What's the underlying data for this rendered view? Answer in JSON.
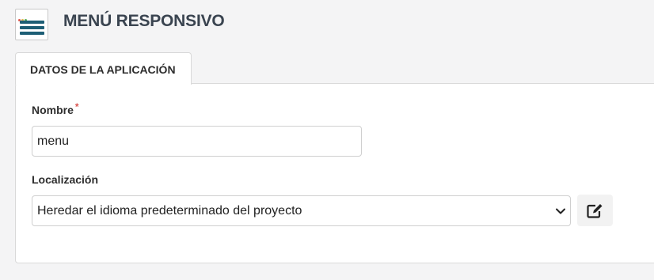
{
  "header": {
    "title": "MENÚ RESPONSIVO",
    "icon": "menu-app-icon",
    "icon_colors": {
      "bars": "#1d5e75",
      "dot_red": "#e05a4f",
      "dot_yellow": "#e0b84f",
      "dot_green": "#5ab05a"
    }
  },
  "tabs": [
    {
      "label": "DATOS DE LA APLICACIÓN",
      "active": true
    }
  ],
  "form": {
    "name": {
      "label": "Nombre",
      "required_mark": "*",
      "value": "menu"
    },
    "localization": {
      "label": "Localización",
      "selected": "Heredar el idioma predeterminado del proyecto",
      "edit_icon": "edit-icon"
    }
  },
  "colors": {
    "title": "#3a4450",
    "required": "#d9534f",
    "background": "#f4f4f5"
  }
}
